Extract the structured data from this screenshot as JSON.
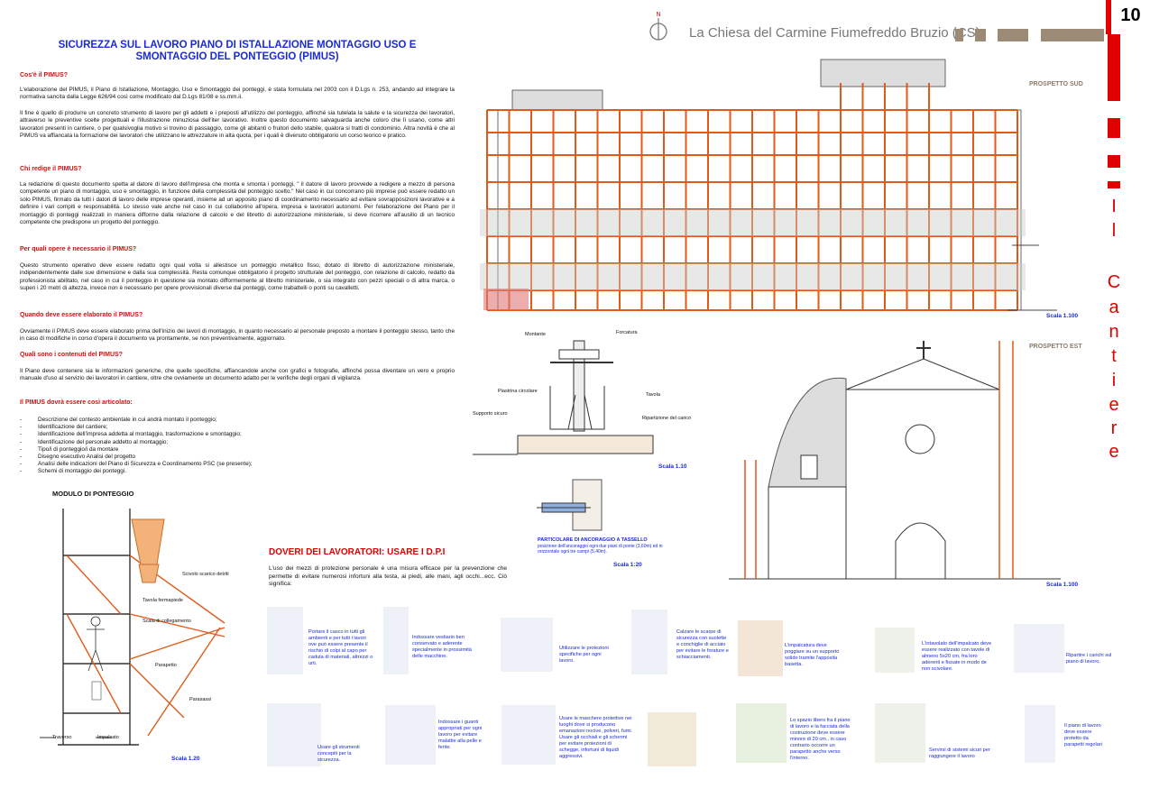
{
  "page_number": "10",
  "header_title": "La Chiesa del Carmine Fiumefreddo Bruzio (CS)",
  "side_word": [
    "I",
    "l",
    "C",
    "a",
    "n",
    "t",
    "i",
    "e",
    "r",
    "e"
  ],
  "compass_label": "N",
  "main_title": "SICUREZZA SUL LAVORO PIANO DI ISTALLAZIONE MONTAGGIO USO E SMONTAGGIO DEL PONTEGGIO (PIMUS)",
  "sections": [
    {
      "q": "Cos'è il PIMUS?",
      "p": "L'elaborazione del PIMUS, il Piano di Istallazione, Montaggio, Uso e Smontaggio dei ponteggi, è stata formulata nel 2003 con il D.Lgs n. 253, andando ad integrare la normativa sancita dalla Legge 626/94 così come modificato dal D.Lgs 81/08 e ss.mm.ii."
    },
    {
      "q": "",
      "p": "Il fine è quello di produrre un concreto strumento di lavoro per gli addetti e i preposti all'utilizzo del ponteggio, affinché sia tutelata la salute e la sicurezza dei lavoratori, attraverso le preventive scelte progettuali e l'illustrazione minuziosa dell'iter lavorativo. Inoltre questo documento salvaguarda anche coloro che lì usano, come altri lavoratori presenti in cantiere, o per qualsivoglia motivo si trovino di passaggio, come gli abitanti o fruitori dello stabile, qualora si tratti di condominio. Altra novità è che al PIMUS va affiancata la formazione dei lavoratori che utilizzano le attrezzature in alta quota, per i quali è divenuto obbligatorio un corso teorico e pratico."
    },
    {
      "q": "Chi redige il PIMUS?",
      "p": "La redazione di questo documento spetta al datore di lavoro dell'impresa che monta e smonta i ponteggi, \" il datore di lavoro provvede a redigere a mezzo di persona competente un piano di montaggio, uso e smontaggio, in funzione della complessità del ponteggio scelto.\" Nel caso in cui concorrano più imprese può essere redatto un solo PIMUS, firmato da tutti i datori di lavoro delle imprese operanti, insieme ad un apposito piano di coordinamento necessario ad evitare sovrapposizioni lavorative e a definire i vari compiti e responsabilità. Lo stesso vale anche nel caso in cui collaborino all'opera, impresa e lavoratori autonomi. Per l'elaborazione del Piano per il montaggio di ponteggi realizzati in maniera difforme dalla relazione di calcolo e del libretto di autorizzazione ministeriale, si deve ricorrere all'ausilio di un tecnico competente che predisponе un progetto del ponteggio."
    },
    {
      "q": "Per quali opere è necessario il PIMUS?",
      "p": "Questo strumento operativo deve essere redatto ogni qual volta si allestisce un ponteggio metallico fisso, dotato di libretto di autorizzazione ministeriale, indipendentemente dalle sue dimensione e dalla sua complessità. Resta comunque obbligatorio il progetto strutturale del ponteggio, con relazione di calcolo, redatto da professionista abilitato, nel caso in cui il ponteggio in questione sia montato difformemente al libretto ministeriale, o sia integrato con pezzi speciali o di altra marca, o superi i 20 metri di altezza, invece non è necessario per opere provvisionali diverse dai ponteggi, come trabattelli o ponti su cavalletti."
    },
    {
      "q": "Quando deve essere elaborato il PIMUS?",
      "p": "Ovviamente il PIMUS deve essere elaborato prima dell'inizio dei lavori di montaggio, in quanto necessario al personale preposto a montare il ponteggio stesso, tanto che in caso di modifiche in corso d'opera il documento va prontamente, se non preventivamente, aggiornato."
    },
    {
      "q": "Quali sono i contenuti del PIMUS?",
      "p": "Il Piano deve contenere sia le informazioni generiche, che quelle specifiche, affiancandole anche con grafici e fotografie, affinché possa diventare un vero e proprio manuale d'uso al servizio dei lavoratori in cantiere, oltre che ovviamente un documento adatto per le verifiche degli organi di vigilanza."
    },
    {
      "q": "Il PIMUS dovrà essere così articolato:",
      "p": ""
    }
  ],
  "list_items": [
    "Descrizione del contesto ambientale in cui andrà montato il ponteggio;",
    "Identificazione del cantiere;",
    "Identificazione dell'impresa addetta al montaggio, trasformazione e smontaggio;",
    "Identificazione del personale addetto al montaggio;",
    "Tipo/i di ponteggio/i da montare",
    "Disegno esecutivo Analisi del progetto",
    "Analisi delle indicazioni del Piano di Sicurezza e Coordinamento PSC (se presente);",
    "Schemi di montaggio dei ponteggi."
  ],
  "module": {
    "title": "MODULO DI PONTEGGIO",
    "labels": {
      "scivolo": "Scivolo scarico detriti",
      "tavola": "Tavola fermapiede",
      "scala": "Scala di collegamento",
      "parapetto": "Parapetto",
      "parasassi": "Parasassi",
      "traverso": "Traverso",
      "impalcato": "Impalcato"
    },
    "scale": "Scala 1.20"
  },
  "prospetto_sud": {
    "label": "PROSPETTO SUD",
    "scale": "Scala 1.100"
  },
  "prospetto_est": {
    "label": "PROSPETTO EST",
    "scale": "Scala 1.100"
  },
  "detail": {
    "labels": {
      "montante": "Montante",
      "forcatura": "Forcatura",
      "piastrina": "Piastrina circolare",
      "tavola": "Tavola",
      "supporto": "Supporto sicuro",
      "ripartizione": "Ripartizione del carico"
    },
    "scale": "Scala 1.10"
  },
  "anchor": {
    "title": "PARTICOLARE DI ANCORAGGIO A TASSELLO",
    "note": "posizione dell'ancoraggio ogni due piani di ponte (3,60m) ed in orizzontale ogni tre campi (5,40m).",
    "scale": "Scala 1:20"
  },
  "dpi": {
    "title": "DOVERI DEI LAVORATORI: USARE I D.P.I",
    "text": "L'uso dei mezzi di protezione personale è una misura efficace per la prevenzione che permette di evitare numerosi infortuni alla testa, ai piedi, alle mani, agli occhi...ecc. Ciò significa:",
    "items": [
      "Portare il casco in tutti gli ambienti e per tutti i lavori ove può essere presente il rischio di colpi al capo per caduta di materiali, attrezzi o urti.",
      "Indossare vestiario ben conservato e aderente specialmente in prossimità delle macchine.",
      "Utilizzare le protezioni specifiche per ogni lavoro.",
      "Calzare le scarpe di sicurezza con suolette e conchiglie di acciaio per evitare le forature e schiacciamenti.",
      "L'impalcatura deve poggiare su un supporto solido tramite l'apposita basetta.",
      "L'intavolato dell'impalcato deve essere realizzato con tavole di almeno 5x20 cm, fra loro aderenti e fissate in modo de non scivolare.",
      "Ripartire i carichi sul piano di lavoro.",
      "Usare gli strumenti concepiti per la sicurezza.",
      "Indossare i guanti appropriati per ogni lavoro per evitare malattie alla pelle e ferite.",
      "Usare le maschere protettive nei luoghi dove si producono emanazioni nocive, polveri, fumi. Usare gli occhiali e gli schermi per evitare proiezioni di schegge, infortuni di liquidi aggressivi.",
      "Lo spazio libero fra il piano di lavoro e la facciata della costruzione deve essere minore di 20 cm., in caso contrario occorre un parapetto anche verso l'interno.",
      "Servirsi di sistemi sicuri per raggiungere il lavoro",
      "Il piano di lavoro deve essere protetto da parapetti regolari"
    ]
  },
  "colors": {
    "accent_red": "#e00000",
    "title_blue": "#1a2bd6",
    "scaffold": "#e05a1a",
    "header_bar": "#9b8b76"
  }
}
